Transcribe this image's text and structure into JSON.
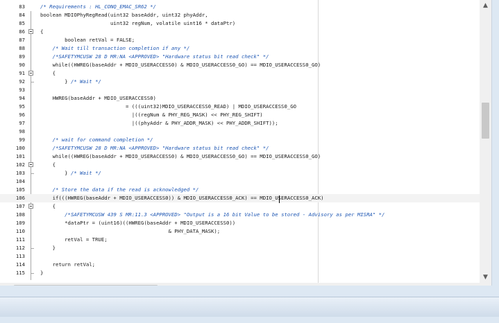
{
  "editor": {
    "current_line": 106,
    "lines": [
      {
        "num": "83",
        "fold": false,
        "segments": [
          [
            "comment",
            "/* Requirements : HL_CONQ_EMAC_SR62 */"
          ]
        ]
      },
      {
        "num": "84",
        "fold": false,
        "segments": [
          [
            "code",
            "boolean MDIOPhyRegRead(uint32 baseAddr, uint32 phyAddr,"
          ]
        ]
      },
      {
        "num": "85",
        "fold": false,
        "segments": [
          [
            "code",
            "                       uint32 regNum, volatile uint16 * dataPtr)"
          ]
        ]
      },
      {
        "num": "86",
        "fold": true,
        "segments": [
          [
            "code",
            "{"
          ]
        ]
      },
      {
        "num": "87",
        "fold": false,
        "segments": [
          [
            "code",
            "        boolean retVal = FALSE;"
          ]
        ]
      },
      {
        "num": "88",
        "fold": false,
        "segments": [
          [
            "code",
            "    "
          ],
          [
            "comment",
            "/* Wait till transaction completion if any */"
          ]
        ]
      },
      {
        "num": "89",
        "fold": false,
        "segments": [
          [
            "code",
            "    "
          ],
          [
            "comment",
            "/*SAFETYMCUSW 28 D MR:NA <APPROVED> \"Hardware status bit read check\" */"
          ]
        ]
      },
      {
        "num": "90",
        "fold": false,
        "segments": [
          [
            "code",
            "    while((HWREG(baseAddr + MDIO_USERACCESS0) & MDIO_USERACCESS0_GO) == MDIO_USERACCESS0_GO)"
          ]
        ]
      },
      {
        "num": "91",
        "fold": true,
        "segments": [
          [
            "code",
            "    {"
          ]
        ]
      },
      {
        "num": "92",
        "fold": false,
        "segments": [
          [
            "code",
            "        } "
          ],
          [
            "comment",
            "/* Wait */"
          ]
        ]
      },
      {
        "num": "93",
        "fold": false,
        "segments": [
          [
            "code",
            ""
          ]
        ]
      },
      {
        "num": "94",
        "fold": false,
        "segments": [
          [
            "code",
            "    HWREG(baseAddr + MDIO_USERACCESS0)"
          ]
        ]
      },
      {
        "num": "95",
        "fold": false,
        "segments": [
          [
            "code",
            "                            = (((uint32)MDIO_USERACCESS0_READ) | MDIO_USERACCESS0_GO"
          ]
        ]
      },
      {
        "num": "96",
        "fold": false,
        "segments": [
          [
            "code",
            "                              |((regNum & PHY_REG_MASK) << PHY_REG_SHIFT)"
          ]
        ]
      },
      {
        "num": "97",
        "fold": false,
        "segments": [
          [
            "code",
            "                              |((phyAddr & PHY_ADDR_MASK) << PHY_ADDR_SHIFT));"
          ]
        ]
      },
      {
        "num": "98",
        "fold": false,
        "segments": [
          [
            "code",
            ""
          ]
        ]
      },
      {
        "num": "99",
        "fold": false,
        "segments": [
          [
            "code",
            "    "
          ],
          [
            "comment",
            "/* wait for command completion */"
          ]
        ]
      },
      {
        "num": "100",
        "fold": false,
        "segments": [
          [
            "code",
            "    "
          ],
          [
            "comment",
            "/*SAFETYMCUSW 28 D MR:NA <APPROVED> \"Hardware status bit read check\" */"
          ]
        ]
      },
      {
        "num": "101",
        "fold": false,
        "segments": [
          [
            "code",
            "    while((HWREG(baseAddr + MDIO_USERACCESS0) & MDIO_USERACCESS0_GO) == MDIO_USERACCESS0_GO)"
          ]
        ]
      },
      {
        "num": "102",
        "fold": true,
        "segments": [
          [
            "code",
            "    {"
          ]
        ]
      },
      {
        "num": "103",
        "fold": false,
        "segments": [
          [
            "code",
            "        } "
          ],
          [
            "comment",
            "/* Wait */"
          ]
        ]
      },
      {
        "num": "104",
        "fold": false,
        "segments": [
          [
            "code",
            ""
          ]
        ]
      },
      {
        "num": "105",
        "fold": false,
        "segments": [
          [
            "code",
            "    "
          ],
          [
            "comment",
            "/* Store the data if the read is acknowledged */"
          ]
        ]
      },
      {
        "num": "106",
        "fold": false,
        "segments": [
          [
            "code",
            "    if(((HWREG(baseAddr + MDIO_USERACCESS0)) & MDIO_USERACCESS0_ACK) == MDIO_USERACCESS0_ACK)"
          ]
        ]
      },
      {
        "num": "107",
        "fold": true,
        "segments": [
          [
            "code",
            "    {"
          ]
        ]
      },
      {
        "num": "108",
        "fold": false,
        "segments": [
          [
            "code",
            "        "
          ],
          [
            "comment",
            "/*SAFETYMCUSW 439 S MR:11.3 <APPROVED> \"Output is a 16 bit Value to be stored - Advisory as per MISRA\" */"
          ]
        ]
      },
      {
        "num": "109",
        "fold": false,
        "segments": [
          [
            "code",
            "        *dataPtr = (uint16)((HWREG(baseAddr + MDIO_USERACCESS0))"
          ]
        ]
      },
      {
        "num": "110",
        "fold": false,
        "segments": [
          [
            "code",
            "                                          & PHY_DATA_MASK);"
          ]
        ]
      },
      {
        "num": "111",
        "fold": false,
        "segments": [
          [
            "code",
            "        retVal = TRUE;"
          ]
        ]
      },
      {
        "num": "112",
        "fold": false,
        "segments": [
          [
            "code",
            "    }"
          ]
        ]
      },
      {
        "num": "113",
        "fold": false,
        "segments": [
          [
            "code",
            ""
          ]
        ]
      },
      {
        "num": "114",
        "fold": false,
        "segments": [
          [
            "code",
            "    return retVal;"
          ]
        ]
      },
      {
        "num": "115",
        "fold": false,
        "segments": [
          [
            "code",
            "}"
          ]
        ]
      }
    ]
  },
  "scrollbars": {
    "vertical": {
      "up_icon": "arrow-up-icon",
      "down_icon": "arrow-down-icon",
      "up_glyph": "▲",
      "down_glyph": "▼"
    },
    "horizontal": {
      "left_icon": "arrow-left-icon",
      "right_icon": "arrow-right-icon",
      "left_glyph": "‹",
      "right_glyph": "›"
    }
  },
  "colors": {
    "comment": "#1d56b3",
    "code": "#1a1a1a",
    "background": "#ffffff",
    "current_line": "#f3f3f3"
  }
}
